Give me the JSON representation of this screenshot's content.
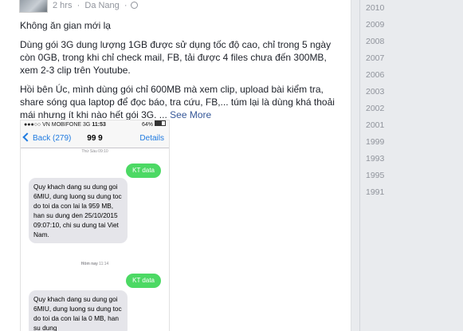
{
  "post": {
    "time": "2 hrs",
    "location": "Da Nang",
    "paragraphs": [
      "Không ăn gian mới lạ",
      "Dùng gói 3G dung lượng 1GB được sử dụng tốc độ cao, chỉ trong 5 ngày còn 0GB, trong khi chỉ check mail, FB, tải được 4 files chưa đến 300MB, xem 2-3 clip trên Youtube.",
      "Hồi bên Úc, mình dùng gói chỉ 600MB mà xem clip, upload bài kiểm tra, share sóng qua laptop để đọc báo, tra cứu, FB,... túm lại là dùng khá thoải mái nhưng ít khi nào hết gói 3G. ..."
    ],
    "see_more": "See More"
  },
  "phone": {
    "carrier": "VN MOBIFONE 3G",
    "clock": "11:53",
    "battery": "64%",
    "back_label": "Back (279)",
    "contact": "99 9",
    "details_label": "Details",
    "stamp1": "Thứ Sáu 09:10",
    "msg1_out": "KT data",
    "msg1_in": "Quy khach dang su dung goi 6MIU, dung luong su dung toc do toi da con lai la 959 MB, han su dung den 25/10/2015 09:07:10, chi su dung tai Viet Nam.",
    "stamp2_day": "Hôm nay",
    "stamp2_time": "11:14",
    "msg2_out": "KT data",
    "msg2_in": "Quy khach dang su dung goi 6MIU, dung luong su dung toc do toi da con lai la 0 MB, han su dung"
  },
  "years": [
    "2010",
    "2009",
    "2008",
    "2007",
    "2006",
    "2003",
    "2002",
    "2001",
    "1999",
    "1993",
    "1995",
    "1991"
  ]
}
